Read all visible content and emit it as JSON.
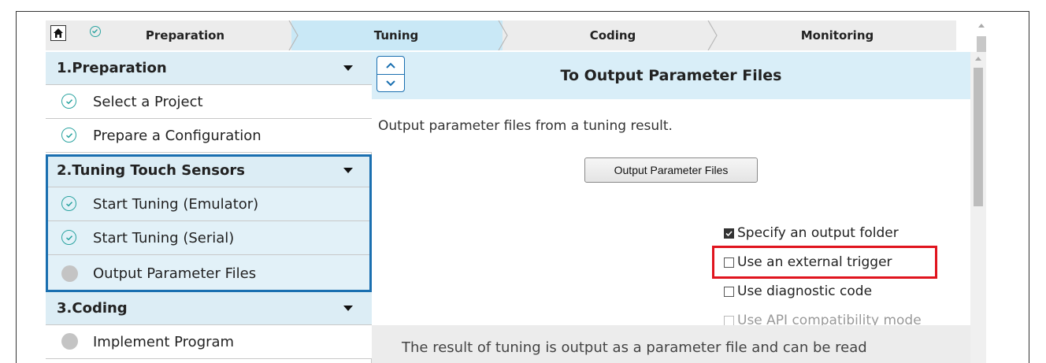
{
  "breadcrumb": {
    "home_icon": "home-icon",
    "steps": [
      {
        "label": "Preparation",
        "state": "done"
      },
      {
        "label": "Tuning",
        "state": "active"
      },
      {
        "label": "Coding",
        "state": "pending"
      },
      {
        "label": "Monitoring",
        "state": "pending"
      }
    ]
  },
  "sidebar": {
    "sections": [
      {
        "label": "1.Preparation",
        "items": [
          {
            "label": "Select a Project",
            "state": "done"
          },
          {
            "label": "Prepare a Configuration",
            "state": "done"
          }
        ]
      },
      {
        "label": "2.Tuning Touch Sensors",
        "items": [
          {
            "label": "Start Tuning (Emulator)",
            "state": "done"
          },
          {
            "label": "Start Tuning (Serial)",
            "state": "done"
          },
          {
            "label": "Output Parameter Files",
            "state": "pending"
          }
        ]
      },
      {
        "label": "3.Coding",
        "items": [
          {
            "label": "Implement Program",
            "state": "pending"
          }
        ]
      }
    ]
  },
  "panel": {
    "title": "To Output Parameter Files",
    "description": "Output parameter files from a tuning result.",
    "button_label": "Output Parameter Files",
    "options": [
      {
        "label": "Specify an output folder",
        "checked": true,
        "enabled": true
      },
      {
        "label": "Use an external trigger",
        "checked": false,
        "enabled": true
      },
      {
        "label": "Use diagnostic code",
        "checked": false,
        "enabled": true
      },
      {
        "label": "Use API compatibility mode",
        "checked": false,
        "enabled": false
      }
    ],
    "footer_text": "The result of tuning is output as a parameter file and can be read"
  },
  "colors": {
    "accent_blue": "#1a6fb0",
    "active_step_bg": "#c9e8f6",
    "check_teal": "#2aa3a0",
    "highlight_red": "#e0141e"
  }
}
